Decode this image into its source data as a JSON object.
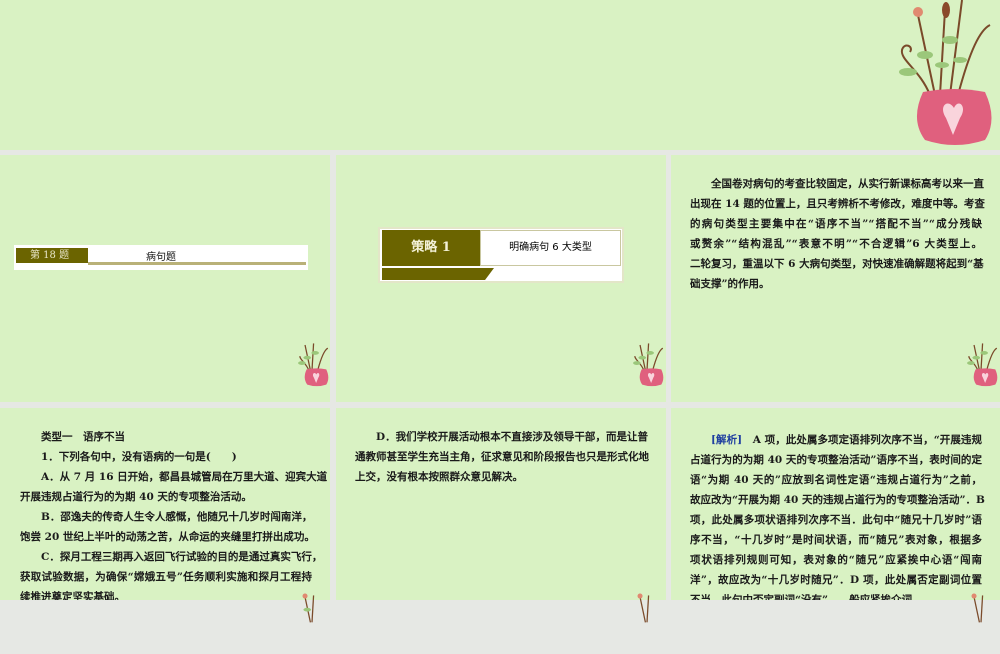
{
  "slide18": {
    "number_label": "第 18 题",
    "title": "病句题"
  },
  "strategy": {
    "label": "策略 1",
    "title": "明确病句 6 大类型"
  },
  "intro": {
    "lines": [
      "全国卷对病句的考查比较固定，从实行新课标高考以来一直",
      "出现在 14 题的位置上，且只考辨析不考修改，难度中等。考查",
      "的病句类型主要集中在“语序不当”“搭配不当”“成分残缺",
      "或赘余”“结构混乱”“表意不明”“不合逻辑”6 大类型上。",
      "二轮复习，重温以下 6 大病句类型，对快速准确解题将起到“基",
      "础支撑”的作用。"
    ]
  },
  "question": {
    "heading": "类型一　语序不当",
    "lines": [
      "1．下列各句中，没有语病的一句是(　　)",
      "A．从 7 月 16 日开始，都昌县城管局在万里大道、迎宾大道",
      "开展违规占道行为的为期 40 天的专项整治活动。",
      "B．邵逸夫的传奇人生令人感慨，他随兄十几岁时闯南洋，",
      "饱尝 20 世纪上半叶的动荡之苦，从命运的夹缝里打拼出成功。",
      "C．探月工程三期再入返回飞行试验的目的是通过真实飞行，",
      "获取试验数据，为确保“嫦娥五号”任务顺利实施和探月工程持",
      "续推进奠定坚实基础。"
    ]
  },
  "option_d": {
    "lines": [
      "D．我们学校开展活动根本不直接涉及领导干部，而是让普",
      "通教师甚至学生充当主角，征求意见和阶段报告也只是形式化地",
      "上交，没有根本按照群众意见解决。"
    ]
  },
  "analysis": {
    "tag": "[解析]",
    "first": "　A 项，此处属多项定语排列次序不当，“开展违规",
    "lines": [
      "占道行为的为期 40 天的专项整治活动”语序不当，表时间的定",
      "语“为期 40 天的”应放到名词性定语“违规占道行为”之前，",
      "故应改为“开展为期 40 天的违规占道行为的专项整治活动”．B",
      "项，此处属多项状语排列次序不当．此句中“随兄十几岁时”语",
      "序不当，“十几岁时”是时间状语，而“随兄”表对象，根据多",
      "项状语排列规则可知，表对象的“随兄”应紧挨中心语“闯南",
      "洋”，故应改为“十几岁时随兄”．D 项，此处属否定副词位置",
      "不当，此句中否定副词“没有”……般应紧挨介词"
    ]
  },
  "colors": {
    "background": "#d9f2c3",
    "accent": "#6b6400",
    "vase": "#e0607e"
  }
}
